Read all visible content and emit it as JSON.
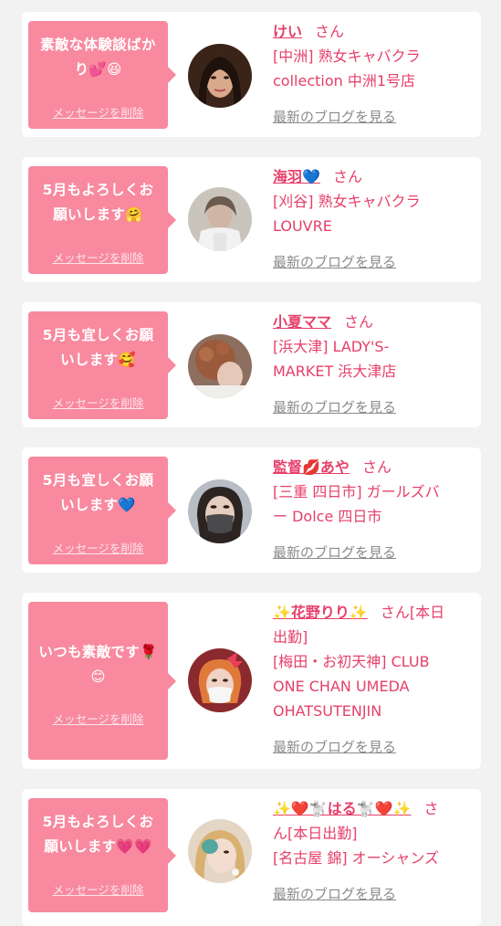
{
  "colors": {
    "accent": "#e63f6a",
    "bubble": "#f8899f",
    "muted": "#8a8a8a",
    "background": "#f2f2f2"
  },
  "entries": [
    {
      "message": [
        "素敵な体験談ばか",
        "り💕😆"
      ],
      "delete_label": "メッセージを削除",
      "name": "けい",
      "suffix": "さん",
      "shop": [
        "[中洲] 熟女キャバクラ",
        "collection 中洲1号店"
      ],
      "blog_label": "最新のブログを見る"
    },
    {
      "message": [
        "5月もよろしくお",
        "願いします🤗"
      ],
      "delete_label": "メッセージを削除",
      "name": "海羽💙",
      "suffix": "さん",
      "shop": [
        "[刈谷] 熟女キャバクラ",
        "LOUVRE"
      ],
      "blog_label": "最新のブログを見る"
    },
    {
      "message": [
        "5月も宜しくお願",
        "いします🥰"
      ],
      "delete_label": "メッセージを削除",
      "name": "小夏ママ",
      "suffix": "さん",
      "shop": [
        "[浜大津] LADY'S-",
        "MARKET 浜大津店"
      ],
      "blog_label": "最新のブログを見る"
    },
    {
      "message": [
        "5月も宜しくお願",
        "いします💙"
      ],
      "delete_label": "メッセージを削除",
      "name": "監督💋あや",
      "suffix": "さん",
      "shop": [
        "[三重 四日市] ガールズバ",
        "ー Dolce 四日市"
      ],
      "blog_label": "最新のブログを見る"
    },
    {
      "message": [
        "いつも素敵です🌹",
        "😊"
      ],
      "delete_label": "メッセージを削除",
      "name": "✨花野りり✨",
      "suffix": "さん[本日",
      "suffix2": "出勤]",
      "shop": [
        "[梅田・お初天神] CLUB",
        "ONE CHAN UMEDA",
        "OHATSUTENJIN"
      ],
      "blog_label": "最新のブログを見る"
    },
    {
      "message": [
        "5月もよろしくお",
        "願いします💗💗"
      ],
      "delete_label": "メッセージを削除",
      "name": "✨❤️🐩はる🐩❤️✨",
      "suffix": "さ",
      "suffix2": "ん[本日出勤]",
      "shop": [
        "[名古屋 錦] オーシャンズ"
      ],
      "blog_label": "最新のブログを見る"
    }
  ]
}
